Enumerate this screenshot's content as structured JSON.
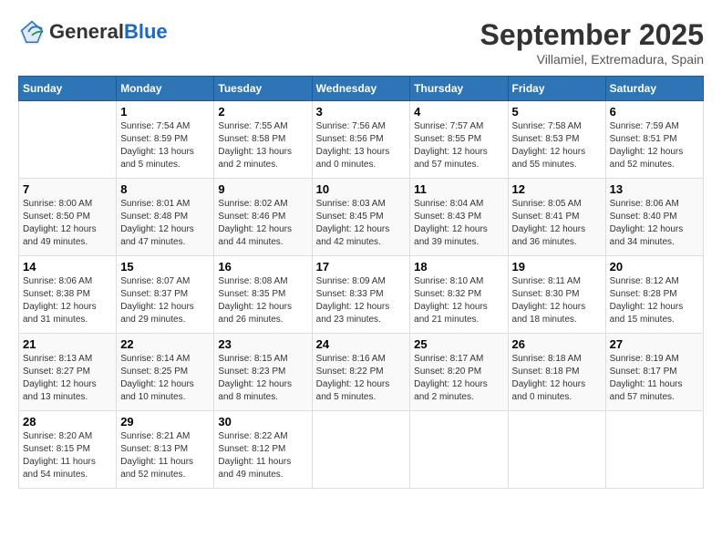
{
  "header": {
    "logo_general": "General",
    "logo_blue": "Blue",
    "month_title": "September 2025",
    "location": "Villamiel, Extremadura, Spain"
  },
  "days_of_week": [
    "Sunday",
    "Monday",
    "Tuesday",
    "Wednesday",
    "Thursday",
    "Friday",
    "Saturday"
  ],
  "weeks": [
    [
      {
        "day": "",
        "info": ""
      },
      {
        "day": "1",
        "info": "Sunrise: 7:54 AM\nSunset: 8:59 PM\nDaylight: 13 hours\nand 5 minutes."
      },
      {
        "day": "2",
        "info": "Sunrise: 7:55 AM\nSunset: 8:58 PM\nDaylight: 13 hours\nand 2 minutes."
      },
      {
        "day": "3",
        "info": "Sunrise: 7:56 AM\nSunset: 8:56 PM\nDaylight: 13 hours\nand 0 minutes."
      },
      {
        "day": "4",
        "info": "Sunrise: 7:57 AM\nSunset: 8:55 PM\nDaylight: 12 hours\nand 57 minutes."
      },
      {
        "day": "5",
        "info": "Sunrise: 7:58 AM\nSunset: 8:53 PM\nDaylight: 12 hours\nand 55 minutes."
      },
      {
        "day": "6",
        "info": "Sunrise: 7:59 AM\nSunset: 8:51 PM\nDaylight: 12 hours\nand 52 minutes."
      }
    ],
    [
      {
        "day": "7",
        "info": "Sunrise: 8:00 AM\nSunset: 8:50 PM\nDaylight: 12 hours\nand 49 minutes."
      },
      {
        "day": "8",
        "info": "Sunrise: 8:01 AM\nSunset: 8:48 PM\nDaylight: 12 hours\nand 47 minutes."
      },
      {
        "day": "9",
        "info": "Sunrise: 8:02 AM\nSunset: 8:46 PM\nDaylight: 12 hours\nand 44 minutes."
      },
      {
        "day": "10",
        "info": "Sunrise: 8:03 AM\nSunset: 8:45 PM\nDaylight: 12 hours\nand 42 minutes."
      },
      {
        "day": "11",
        "info": "Sunrise: 8:04 AM\nSunset: 8:43 PM\nDaylight: 12 hours\nand 39 minutes."
      },
      {
        "day": "12",
        "info": "Sunrise: 8:05 AM\nSunset: 8:41 PM\nDaylight: 12 hours\nand 36 minutes."
      },
      {
        "day": "13",
        "info": "Sunrise: 8:06 AM\nSunset: 8:40 PM\nDaylight: 12 hours\nand 34 minutes."
      }
    ],
    [
      {
        "day": "14",
        "info": "Sunrise: 8:06 AM\nSunset: 8:38 PM\nDaylight: 12 hours\nand 31 minutes."
      },
      {
        "day": "15",
        "info": "Sunrise: 8:07 AM\nSunset: 8:37 PM\nDaylight: 12 hours\nand 29 minutes."
      },
      {
        "day": "16",
        "info": "Sunrise: 8:08 AM\nSunset: 8:35 PM\nDaylight: 12 hours\nand 26 minutes."
      },
      {
        "day": "17",
        "info": "Sunrise: 8:09 AM\nSunset: 8:33 PM\nDaylight: 12 hours\nand 23 minutes."
      },
      {
        "day": "18",
        "info": "Sunrise: 8:10 AM\nSunset: 8:32 PM\nDaylight: 12 hours\nand 21 minutes."
      },
      {
        "day": "19",
        "info": "Sunrise: 8:11 AM\nSunset: 8:30 PM\nDaylight: 12 hours\nand 18 minutes."
      },
      {
        "day": "20",
        "info": "Sunrise: 8:12 AM\nSunset: 8:28 PM\nDaylight: 12 hours\nand 15 minutes."
      }
    ],
    [
      {
        "day": "21",
        "info": "Sunrise: 8:13 AM\nSunset: 8:27 PM\nDaylight: 12 hours\nand 13 minutes."
      },
      {
        "day": "22",
        "info": "Sunrise: 8:14 AM\nSunset: 8:25 PM\nDaylight: 12 hours\nand 10 minutes."
      },
      {
        "day": "23",
        "info": "Sunrise: 8:15 AM\nSunset: 8:23 PM\nDaylight: 12 hours\nand 8 minutes."
      },
      {
        "day": "24",
        "info": "Sunrise: 8:16 AM\nSunset: 8:22 PM\nDaylight: 12 hours\nand 5 minutes."
      },
      {
        "day": "25",
        "info": "Sunrise: 8:17 AM\nSunset: 8:20 PM\nDaylight: 12 hours\nand 2 minutes."
      },
      {
        "day": "26",
        "info": "Sunrise: 8:18 AM\nSunset: 8:18 PM\nDaylight: 12 hours\nand 0 minutes."
      },
      {
        "day": "27",
        "info": "Sunrise: 8:19 AM\nSunset: 8:17 PM\nDaylight: 11 hours\nand 57 minutes."
      }
    ],
    [
      {
        "day": "28",
        "info": "Sunrise: 8:20 AM\nSunset: 8:15 PM\nDaylight: 11 hours\nand 54 minutes."
      },
      {
        "day": "29",
        "info": "Sunrise: 8:21 AM\nSunset: 8:13 PM\nDaylight: 11 hours\nand 52 minutes."
      },
      {
        "day": "30",
        "info": "Sunrise: 8:22 AM\nSunset: 8:12 PM\nDaylight: 11 hours\nand 49 minutes."
      },
      {
        "day": "",
        "info": ""
      },
      {
        "day": "",
        "info": ""
      },
      {
        "day": "",
        "info": ""
      },
      {
        "day": "",
        "info": ""
      }
    ]
  ]
}
